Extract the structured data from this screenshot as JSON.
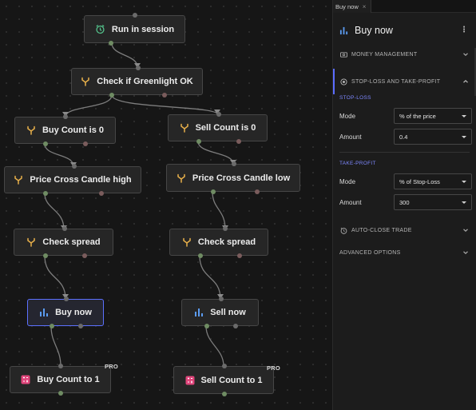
{
  "canvas": {
    "nodes": [
      {
        "id": "run_in_session",
        "label": "Run in session",
        "icon": "alarm-clock-icon",
        "selected": false,
        "pro": false
      },
      {
        "id": "check_greenlight",
        "label": "Check if Greenlight OK",
        "icon": "branch-icon",
        "selected": false,
        "pro": false
      },
      {
        "id": "buy_count_is_0",
        "label": "Buy Count is 0",
        "icon": "branch-icon",
        "selected": false,
        "pro": false
      },
      {
        "id": "sell_count_is_0",
        "label": "Sell Count is 0",
        "icon": "branch-icon",
        "selected": false,
        "pro": false
      },
      {
        "id": "price_cross_high",
        "label": "Price Cross Candle high",
        "icon": "branch-icon",
        "selected": false,
        "pro": false
      },
      {
        "id": "price_cross_low",
        "label": "Price Cross Candle low",
        "icon": "branch-icon",
        "selected": false,
        "pro": false
      },
      {
        "id": "check_spread_left",
        "label": "Check spread",
        "icon": "branch-icon",
        "selected": false,
        "pro": false
      },
      {
        "id": "check_spread_right",
        "label": "Check spread",
        "icon": "branch-icon",
        "selected": false,
        "pro": false
      },
      {
        "id": "buy_now",
        "label": "Buy now",
        "icon": "bar-chart-icon",
        "selected": true,
        "pro": false
      },
      {
        "id": "sell_now",
        "label": "Sell now",
        "icon": "bar-chart-icon",
        "selected": false,
        "pro": false
      },
      {
        "id": "buy_count_to_1",
        "label": "Buy Count to 1",
        "icon": "calculator-icon",
        "selected": false,
        "pro": true
      },
      {
        "id": "sell_count_to_1",
        "label": "Sell Count to 1",
        "icon": "calculator-icon",
        "selected": false,
        "pro": true
      }
    ],
    "pro_label": "PRO"
  },
  "panel": {
    "tab": {
      "label": "Buy now",
      "close": "×"
    },
    "header": {
      "title": "Buy now",
      "menu": "⋮"
    },
    "sections": {
      "money_management": "MONEY MANAGEMENT",
      "stop_loss_take_profit": "STOP-LOSS AND TAKE-PROFIT",
      "auto_close": "AUTO-CLOSE TRADE",
      "advanced": "ADVANCED OPTIONS"
    },
    "stop_loss": {
      "label": "STOP-LOSS",
      "mode_label": "Mode",
      "mode_value": "% of the price",
      "amount_label": "Amount",
      "amount_value": "0.4"
    },
    "take_profit": {
      "label": "TAKE-PROFIT",
      "mode_label": "Mode",
      "mode_value": "% of Stop-Loss",
      "amount_label": "Amount",
      "amount_value": "300"
    }
  },
  "colors": {
    "accent": "#5c71ff",
    "branch_icon": "#e8b04a",
    "clock_icon": "#54c28c",
    "chart_icon": "#5b9bf0",
    "calc_icon": "#e0457b"
  }
}
